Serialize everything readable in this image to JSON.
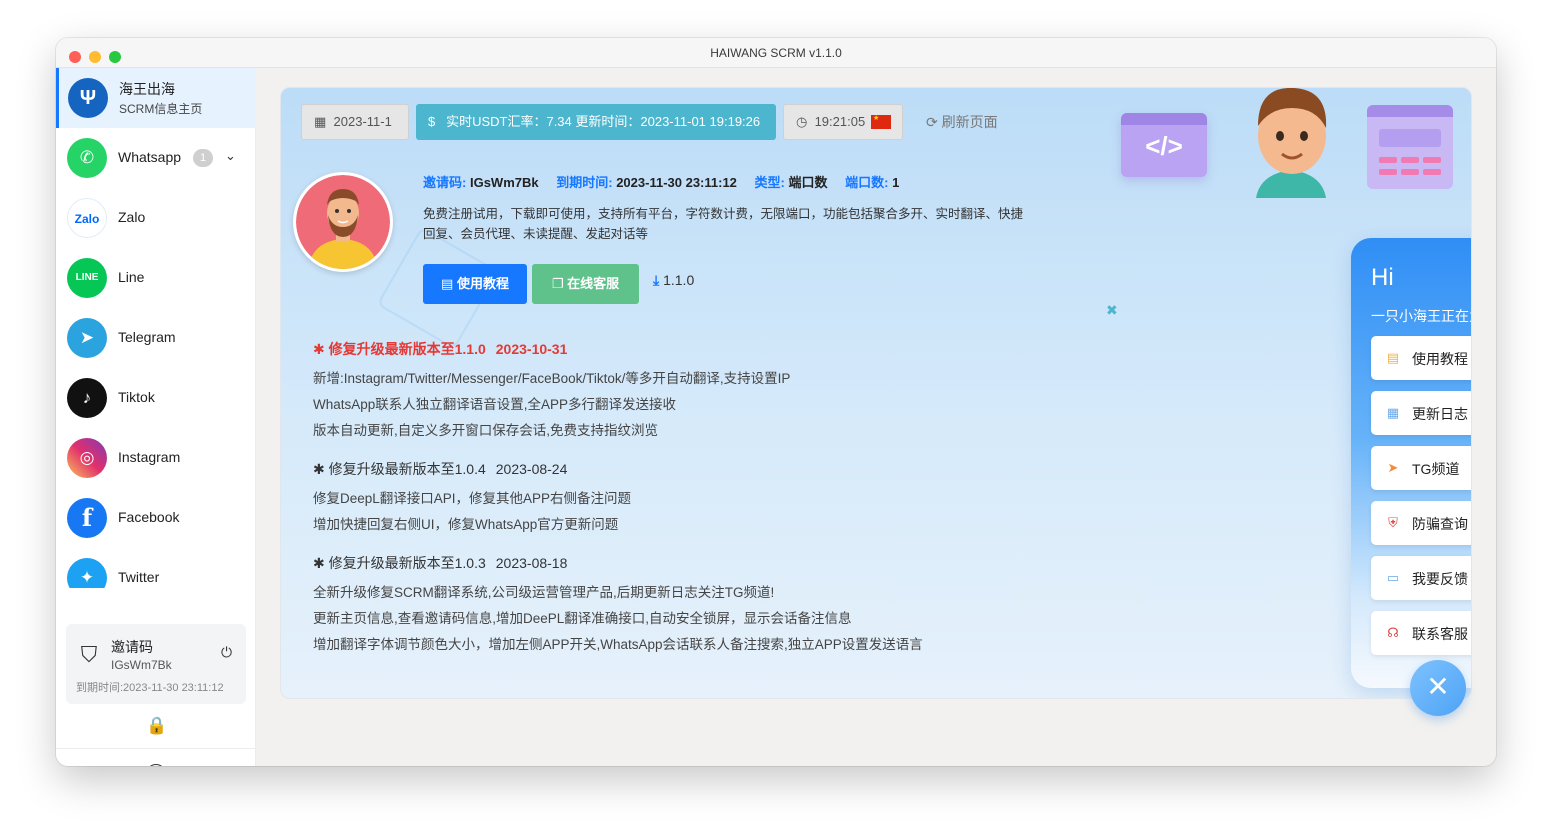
{
  "window": {
    "title": "HAIWANG SCRM v1.1.0"
  },
  "brand": {
    "logo_glyph": "Ψ",
    "title": "海王出海",
    "subtitle": "SCRM信息主页"
  },
  "nav": [
    {
      "label": "Whatsapp",
      "badge": "1",
      "chevron": "⌄",
      "glyph": "✆",
      "color": "#25d366"
    },
    {
      "label": "Zalo",
      "glyph": "Zalo",
      "color": "#0068ff"
    },
    {
      "label": "Line",
      "glyph": "LINE",
      "color": "#06c755"
    },
    {
      "label": "Telegram",
      "glyph": "➤",
      "color": "#2aa3de"
    },
    {
      "label": "Tiktok",
      "glyph": "♪",
      "color": "#111111"
    },
    {
      "label": "Instagram",
      "glyph": "◎",
      "color": "#d6249f"
    },
    {
      "label": "Facebook",
      "glyph": "f",
      "color": "#1877f2"
    },
    {
      "label": "Twitter",
      "glyph": "✦",
      "color": "#1da1f2"
    }
  ],
  "invite": {
    "title": "邀请码",
    "code": "IGsWm7Bk",
    "expiry": "到期时间:2023-11-30 23:11:12",
    "icon_glyph": "⛉",
    "power_glyph": "⏻"
  },
  "sidebar_footer": {
    "lock_glyph": "🔒",
    "collapse_glyph": "‹"
  },
  "toolbar": {
    "date": "2023-11-1",
    "date_icon": "▦",
    "rate": "实时USDT汇率：7.34 更新时间：2023-11-01 19:19:26",
    "rate_icon": "$",
    "time": "19:21:05",
    "time_icon": "◷",
    "refresh": "刷新页面",
    "refresh_icon": "⟳"
  },
  "profile": {
    "invite_label": "邀请码:",
    "invite_value": "IGsWm7Bk",
    "expiry_label": "到期时间:",
    "expiry_value": "2023-11-30 23:11:12",
    "type_label": "类型:",
    "type_value": "端口数",
    "ports_label": "端口数:",
    "ports_value": "1",
    "description": "免费注册试用，下载即可使用，支持所有平台，字符数计费，无限端口，功能包括聚合多开、实时翻译、快捷回复、会员代理、未读提醒、发起对话等",
    "tutorial_button": "使用教程",
    "support_button": "在线客服",
    "download_version": "1.1.0",
    "download_icon": "⤓"
  },
  "changelog": [
    {
      "title": "✱ 修复升级最新版本至1.1.0",
      "date": "2023-10-31",
      "lines": [
        "新增:Instagram/Twitter/Messenger/FaceBook/Tiktok/等多开自动翻译,支持设置IP",
        "WhatsApp联系人独立翻译语音设置,全APP多行翻译发送接收",
        "版本自动更新,自定义多开窗口保存会话,免费支持指纹浏览"
      ]
    },
    {
      "title": "✱ 修复升级最新版本至1.0.4",
      "date": "2023-08-24",
      "lines": [
        "修复DeepL翻译接口API，修复其他APP右侧备注问题",
        "增加快捷回复右侧UI，修复WhatsApp官方更新问题"
      ]
    },
    {
      "title": "✱ 修复升级最新版本至1.0.3",
      "date": "2023-08-18",
      "lines": [
        "全新升级修复SCRM翻译系统,公司级运营管理产品,后期更新日志关注TG频道!",
        "更新主页信息,查看邀请码信息,增加DeePL翻译准确接口,自动安全锁屏，显示会话备注信息",
        "增加翻译字体调节颜色大小，增加左侧APP开关,WhatsApp会话联系人备注搜索,独立APP设置发送语言"
      ]
    }
  ],
  "assistant": {
    "greeting": "Hi",
    "subtitle": "一只小海王正在为您服务",
    "close_glyph": "×",
    "items": [
      {
        "label": "使用教程",
        "glyph": "▤",
        "color": "#f0b440"
      },
      {
        "label": "更新日志",
        "glyph": "▦",
        "color": "#6aa9e9"
      },
      {
        "label": "TG频道",
        "glyph": "➤",
        "color": "#f28c3c"
      },
      {
        "label": "防骗查询",
        "glyph": "⛨",
        "color": "#e04848"
      },
      {
        "label": "我要反馈",
        "glyph": "▭",
        "color": "#6aa9e9"
      },
      {
        "label": "联系客服",
        "glyph": "☊",
        "color": "#e04848"
      }
    ],
    "fab_glyph": "✕"
  },
  "illustration": {
    "code_glyph": "</>",
    "spark_glyph": "✖"
  }
}
